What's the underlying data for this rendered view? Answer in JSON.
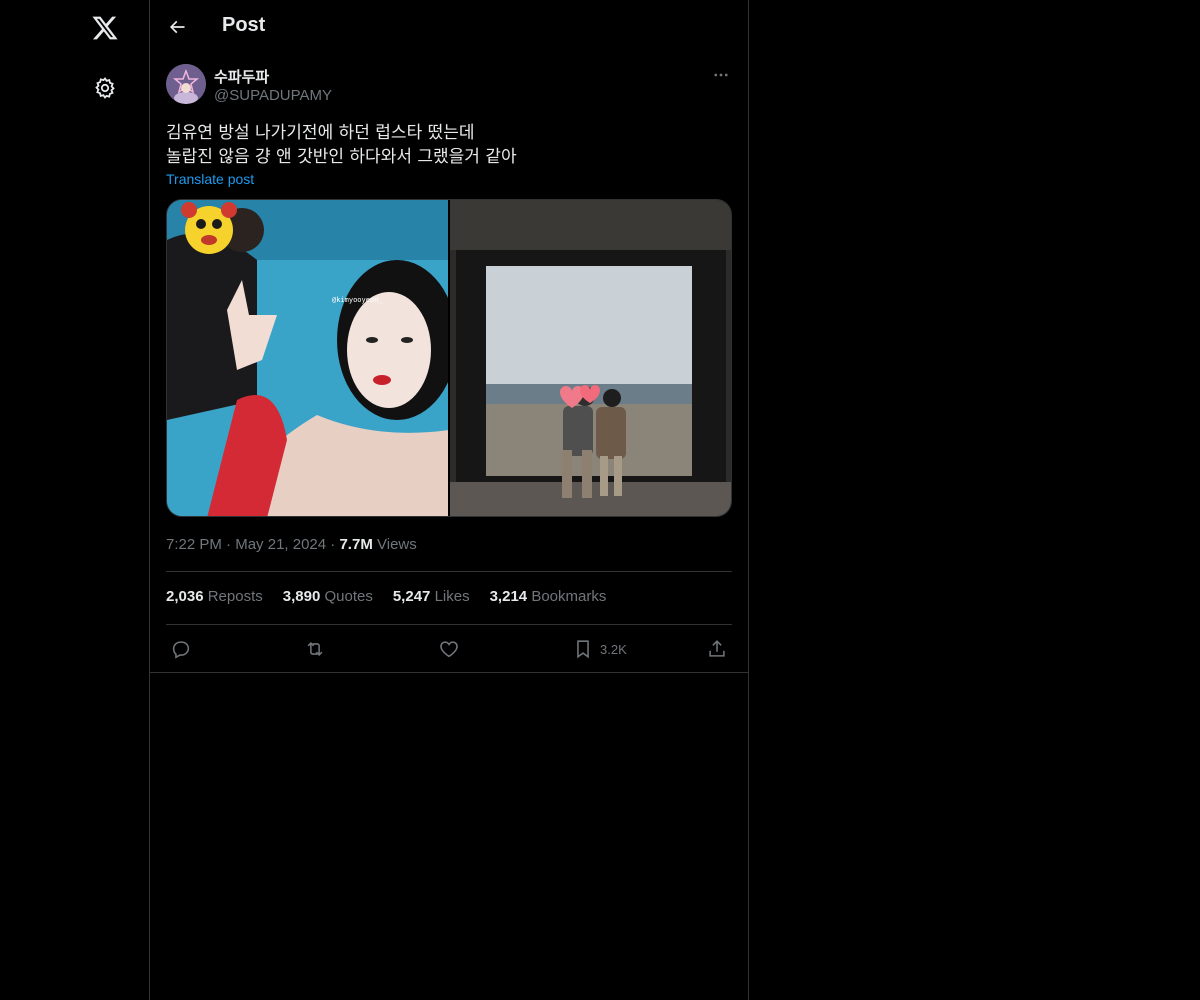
{
  "nav": {
    "logo_icon": "x-logo-icon",
    "settings_icon": "gear-icon"
  },
  "header": {
    "title": "Post",
    "back_icon": "arrow-left-icon"
  },
  "post": {
    "display_name": "수파두파",
    "handle": "@SUPADUPAMY",
    "text_lines": [
      "김유연 방설 나가기전에 하던 럽스타 떴는데",
      "놀랍진 않음 걍 앤 갓반인 하다와서 그랬을거 같아"
    ],
    "translate_label": "Translate post",
    "media": [
      {
        "description_icon": "photo-pool-selfie",
        "watermark": "@kimyooyeon_"
      },
      {
        "description_icon": "photo-couple-window"
      }
    ],
    "time": "7:22 PM",
    "date": "May 21, 2024",
    "views_count": "7.7M",
    "views_label": "Views",
    "stats": [
      {
        "count": "2,036",
        "label": "Reposts"
      },
      {
        "count": "3,890",
        "label": "Quotes"
      },
      {
        "count": "5,247",
        "label": "Likes"
      },
      {
        "count": "3,214",
        "label": "Bookmarks"
      }
    ],
    "actions": {
      "bookmark_count": "3.2K"
    }
  },
  "colors": {
    "background": "#000000",
    "text": "#e7e9ea",
    "muted": "#71767b",
    "link": "#1d9bf0",
    "border": "#2f3336"
  }
}
